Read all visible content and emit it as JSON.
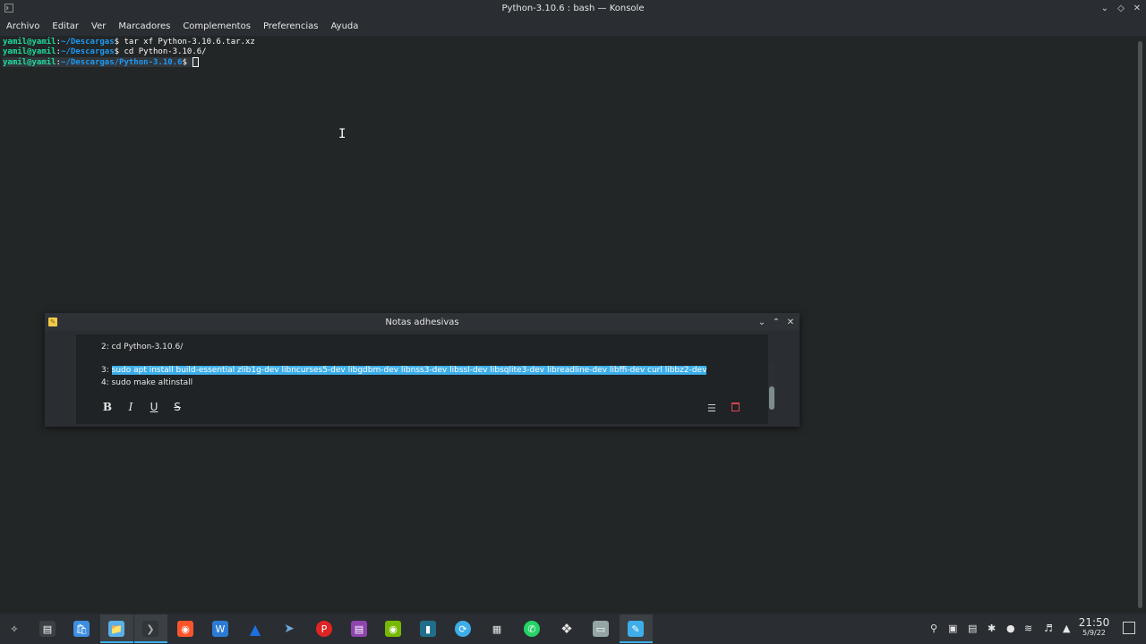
{
  "window": {
    "title": "Python-3.10.6 : bash — Konsole",
    "menu": [
      "Archivo",
      "Editar",
      "Ver",
      "Marcadores",
      "Complementos",
      "Preferencias",
      "Ayuda"
    ]
  },
  "terminal": {
    "user": "yamil@yamil",
    "lines": [
      {
        "path": "~/Descargas",
        "command": "tar xf Python-3.10.6.tar.xz"
      },
      {
        "path": "~/Descargas",
        "command": "cd Python-3.10.6/"
      },
      {
        "path": "~/Descargas/Python-3.10.6",
        "command": ""
      }
    ]
  },
  "sticky_note": {
    "title": "Notas adhesivas",
    "lines": {
      "line2": "2: cd Python-3.10.6/",
      "line3_prefix": "3: ",
      "line3_selected": "sudo apt install build-essential zlib1g-dev libncurses5-dev libgdbm-dev libnss3-dev libssl-dev libsqlite3-dev libreadline-dev libffi-dev curl libbz2-dev",
      "line4": "4: sudo make altinstall"
    },
    "format_buttons": {
      "bold": "B",
      "italic": "I",
      "underline": "U",
      "strike": "S"
    }
  },
  "taskbar": {
    "clock_time": "21:50",
    "clock_date": "5/9/22"
  },
  "colors": {
    "background": "#232627",
    "prompt_user": "#1cdc9a",
    "prompt_path": "#1d99f3",
    "selection": "#3daee9"
  }
}
